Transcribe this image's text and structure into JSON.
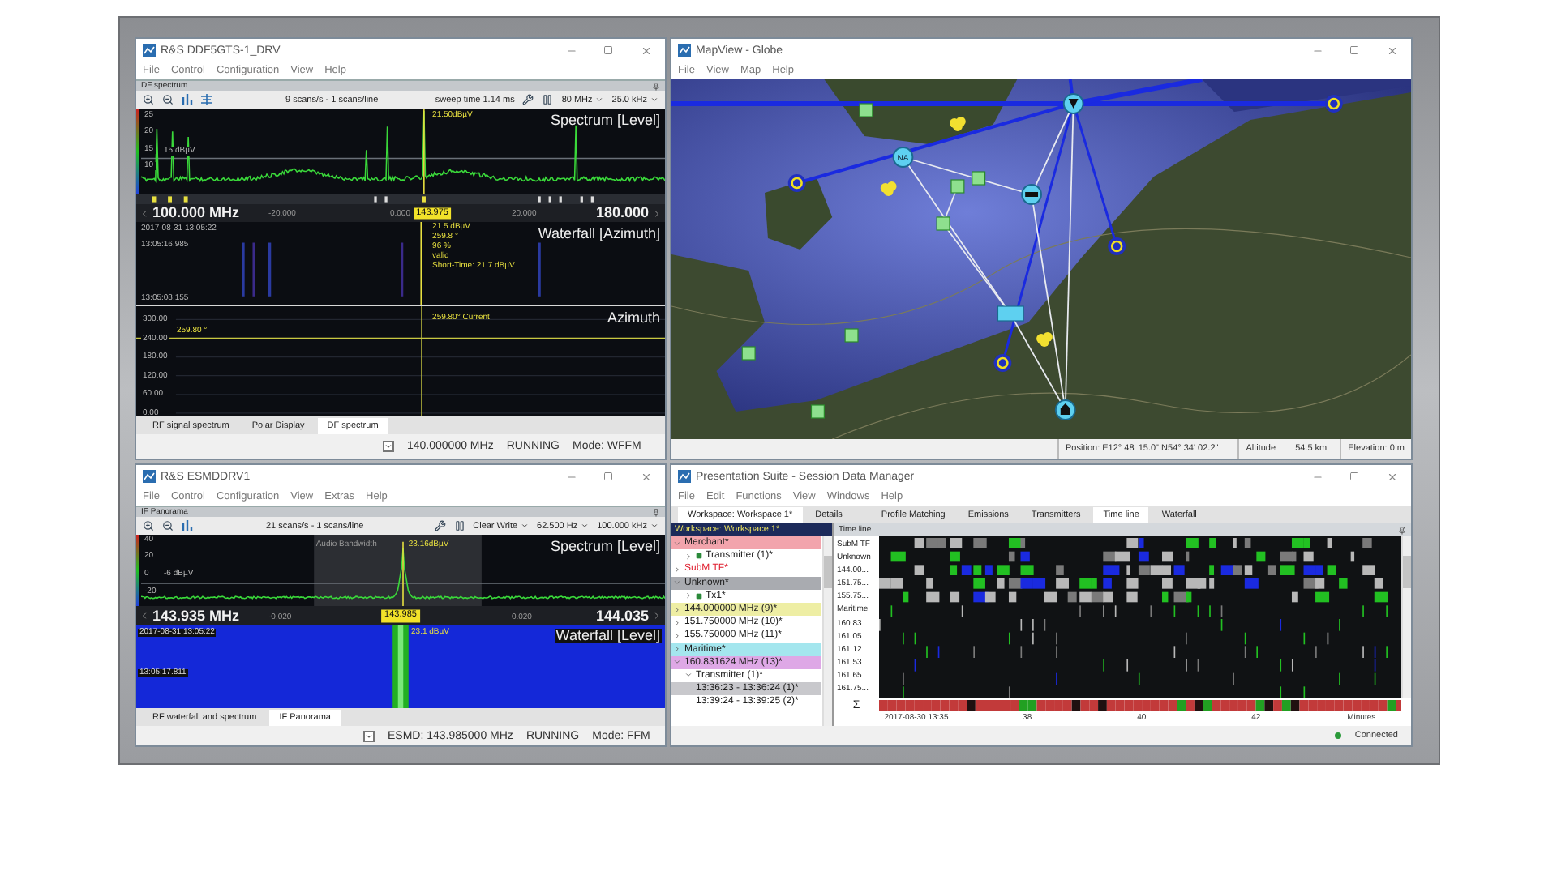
{
  "df_receiver": {
    "title": "R&S DDF5GTS-1_DRV",
    "menu": [
      "File",
      "Control",
      "Configuration",
      "View",
      "Help"
    ],
    "panel_title": "DF spectrum",
    "toolbar": {
      "scan_rate": "9 scans/s - 1 scans/line",
      "sweep_time": "sweep time 1.14 ms",
      "span": "80 MHz",
      "resolution": "25.0 kHz"
    },
    "spectrum": {
      "label": "Spectrum [Level]",
      "y_ticks": [
        "25",
        "20",
        "15",
        "10"
      ],
      "reference": "15 dBµV",
      "marker": "21.50dBµV"
    },
    "axis": {
      "start": "100.000  MHz",
      "ticks": [
        "-20.000",
        "0.000",
        "20.000"
      ],
      "center": "143.975",
      "stop": "180.000"
    },
    "waterfall": {
      "label": "Waterfall [Azimuth]",
      "start_time": "2017-08-31 13:05:22",
      "cursor_time": "13:05:16.985",
      "end_time": "13:05:08.155",
      "marker_info": [
        "21.5 dBµV",
        "259.8 °",
        "96 %",
        "valid",
        "Short-Time: 21.7 dBµV"
      ]
    },
    "azimuth": {
      "label": "Azimuth",
      "y_ticks": [
        "300.00",
        "240.00",
        "180.00",
        "120.00",
        "60.00",
        "0.00"
      ],
      "marker": "259.80 °",
      "current": "259.80° Current"
    },
    "tabs": [
      {
        "label": "RF signal spectrum",
        "selected": false
      },
      {
        "label": "Polar Display",
        "selected": false
      },
      {
        "label": "DF spectrum",
        "selected": true
      }
    ],
    "status": {
      "frequency": "140.000000 MHz",
      "state": "RUNNING",
      "mode": "Mode: WFFM"
    }
  },
  "map_view": {
    "title": "MapView - Globe",
    "menu": [
      "File",
      "View",
      "Map",
      "Help"
    ],
    "station_label": "NA",
    "status": {
      "position": "Position: E12° 48' 15.0\"  N54° 34' 02.2\"",
      "altitude_label": "Altitude",
      "altitude": "54.5 km",
      "elevation": "Elevation: 0 m"
    }
  },
  "esmd_receiver": {
    "title": "R&S ESMDDRV1",
    "menu": [
      "File",
      "Control",
      "Configuration",
      "View",
      "Extras",
      "Help"
    ],
    "panel_title": "IF Panorama",
    "toolbar": {
      "scan_rate": "21 scans/s - 1 scans/line",
      "trace_mode": "Clear Write",
      "bandwidth": "62.500 Hz",
      "span": "100.000 kHz"
    },
    "spectrum": {
      "label": "Spectrum [Level]",
      "y_ticks": [
        "40",
        "20",
        "0",
        "-20"
      ],
      "reference": "-6 dBµV",
      "audio_bandwidth": "Audio Bandwidth",
      "marker": "23.16dBµV"
    },
    "axis": {
      "start": "143.935  MHz",
      "ticks": [
        "-0.020",
        "0.020"
      ],
      "center": "143.985",
      "stop": "144.035"
    },
    "waterfall": {
      "label": "Waterfall [Level]",
      "start_time": "2017-08-31 13:05:22",
      "cursor_time": "13:05:17.811",
      "marker": "23.1 dBµV"
    },
    "tabs": [
      {
        "label": "RF waterfall and spectrum",
        "selected": false
      },
      {
        "label": "IF Panorama",
        "selected": true
      }
    ],
    "status": {
      "frequency": "ESMD: 143.985000 MHz",
      "state": "RUNNING",
      "mode": "Mode: FFM"
    }
  },
  "session": {
    "title": "Presentation Suite - Session Data Manager",
    "menu": [
      "File",
      "Edit",
      "Functions",
      "View",
      "Windows",
      "Help"
    ],
    "workspace_tabs": [
      {
        "label": "Workspace: Workspace 1*",
        "selected": true
      },
      {
        "label": "Details",
        "selected": false
      }
    ],
    "view_tabs": [
      {
        "label": "Profile Matching",
        "selected": false
      },
      {
        "label": "Emissions",
        "selected": false
      },
      {
        "label": "Transmitters",
        "selected": false
      },
      {
        "label": "Time line",
        "selected": true
      },
      {
        "label": "Waterfall",
        "selected": false
      }
    ],
    "tree_header": "Workspace: Workspace 1*",
    "tree": [
      {
        "label": "Merchant*",
        "kind": "band",
        "color": "#f2a4ac",
        "expanded": true,
        "selected": false,
        "children": [
          {
            "label": "Transmitter (1)*",
            "kind": "transmitter",
            "expanded": false,
            "selected": false
          }
        ]
      },
      {
        "label": "SubM TF*",
        "kind": "label",
        "color": "#e02030",
        "expanded": false,
        "selected": false
      },
      {
        "label": "Unknown*",
        "kind": "band",
        "color": "#a9abb0",
        "expanded": true,
        "selected": false,
        "children": [
          {
            "label": "Tx1*",
            "kind": "transmitter",
            "expanded": false,
            "selected": false
          }
        ]
      },
      {
        "label": "144.000000 MHz  (9)*",
        "kind": "band",
        "color": "#eeeea4",
        "expanded": false,
        "selected": false
      },
      {
        "label": "151.750000 MHz  (10)*",
        "expanded": false,
        "selected": false
      },
      {
        "label": "155.750000 MHz  (11)*",
        "expanded": false,
        "selected": false
      },
      {
        "label": "Maritime*",
        "kind": "band",
        "color": "#a4e6ee",
        "expanded": false,
        "selected": false
      },
      {
        "label": "160.831624 MHz  (13)*",
        "kind": "band",
        "color": "#dea8e6",
        "expanded": true,
        "selected": false,
        "children": [
          {
            "label": "Transmitter (1)*",
            "expanded": true,
            "selected": false,
            "children": [
              {
                "label": "13:36:23 - 13:36:24  (1)*",
                "selected": true
              },
              {
                "label": "13:39:24 - 13:39:25  (2)*",
                "selected": false
              }
            ]
          }
        ]
      }
    ],
    "timeline": {
      "title": "Time line",
      "rows": [
        "SubM TF",
        "Unknown",
        "144.00...",
        "151.75...",
        "155.75...",
        "Maritime",
        "160.83...",
        "161.05...",
        "161.12...",
        "161.53...",
        "161.65...",
        "161.75..."
      ],
      "sum_label": "Σ",
      "x_ticks": [
        "2017-08-30 13:35",
        "38",
        "40",
        "42"
      ],
      "x_unit": "Minutes"
    },
    "status": "Connected"
  }
}
